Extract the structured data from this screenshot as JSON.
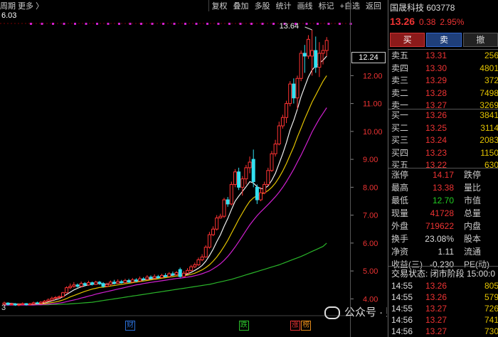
{
  "toolbar": {
    "crumb": "周期 更多 〉",
    "menu": [
      "复权",
      "叠加",
      "多股",
      "统计",
      "画线",
      "标记",
      "+自选",
      "返回"
    ]
  },
  "ma_label": "6.03",
  "chart_data": {
    "type": "candlestick",
    "y_ticks": [
      "12.00",
      "11.00",
      "10.00",
      "9.00",
      "8.00",
      "7.00",
      "6.00",
      "5.00",
      "4.00"
    ],
    "ylim": [
      3.5,
      14.2
    ],
    "current_price_tag": "12.24",
    "high_annotation": "13.64",
    "x_start_label": "3",
    "events": [
      {
        "label": "财",
        "color": "#2b6fd6"
      },
      {
        "label": "跌",
        "color": "#2bbf2b"
      },
      {
        "label": "涨",
        "color": "#e33333"
      },
      {
        "label": "榜",
        "color": "#e38a1a"
      }
    ],
    "candles": [
      {
        "o": 3.8,
        "c": 3.85,
        "h": 3.9,
        "l": 3.75
      },
      {
        "o": 3.85,
        "c": 3.8,
        "h": 3.88,
        "l": 3.76
      },
      {
        "o": 3.8,
        "c": 3.82,
        "h": 3.86,
        "l": 3.77
      },
      {
        "o": 3.82,
        "c": 3.78,
        "h": 3.85,
        "l": 3.75
      },
      {
        "o": 3.78,
        "c": 3.8,
        "h": 3.84,
        "l": 3.74
      },
      {
        "o": 3.8,
        "c": 3.83,
        "h": 3.87,
        "l": 3.78
      },
      {
        "o": 3.83,
        "c": 3.79,
        "h": 3.85,
        "l": 3.76
      },
      {
        "o": 3.79,
        "c": 3.82,
        "h": 3.86,
        "l": 3.77
      },
      {
        "o": 3.82,
        "c": 3.86,
        "h": 3.9,
        "l": 3.8
      },
      {
        "o": 3.86,
        "c": 3.84,
        "h": 3.9,
        "l": 3.8
      },
      {
        "o": 3.84,
        "c": 3.88,
        "h": 3.92,
        "l": 3.82
      },
      {
        "o": 3.88,
        "c": 3.92,
        "h": 3.96,
        "l": 3.85
      },
      {
        "o": 3.92,
        "c": 3.96,
        "h": 4.02,
        "l": 3.9
      },
      {
        "o": 3.96,
        "c": 4.02,
        "h": 4.08,
        "l": 3.92
      },
      {
        "o": 4.02,
        "c": 4.05,
        "h": 4.1,
        "l": 3.98
      },
      {
        "o": 4.05,
        "c": 4.08,
        "h": 4.12,
        "l": 4.0
      },
      {
        "o": 4.08,
        "c": 4.22,
        "h": 4.25,
        "l": 4.05
      },
      {
        "o": 4.22,
        "c": 4.4,
        "h": 4.45,
        "l": 4.2
      },
      {
        "o": 4.4,
        "c": 4.45,
        "h": 4.55,
        "l": 4.35
      },
      {
        "o": 4.45,
        "c": 4.5,
        "h": 4.6,
        "l": 4.4
      },
      {
        "o": 4.5,
        "c": 4.45,
        "h": 4.55,
        "l": 4.4
      },
      {
        "o": 4.45,
        "c": 4.55,
        "h": 4.62,
        "l": 4.42
      },
      {
        "o": 4.55,
        "c": 4.5,
        "h": 4.6,
        "l": 4.45
      },
      {
        "o": 4.5,
        "c": 4.58,
        "h": 4.65,
        "l": 4.47
      },
      {
        "o": 4.58,
        "c": 4.52,
        "h": 4.62,
        "l": 4.48
      },
      {
        "o": 4.52,
        "c": 4.6,
        "h": 4.65,
        "l": 4.5
      },
      {
        "o": 4.6,
        "c": 4.55,
        "h": 4.64,
        "l": 4.5
      },
      {
        "o": 4.55,
        "c": 4.45,
        "h": 4.6,
        "l": 4.4
      },
      {
        "o": 4.45,
        "c": 4.52,
        "h": 4.58,
        "l": 4.42
      },
      {
        "o": 4.52,
        "c": 4.6,
        "h": 4.66,
        "l": 4.48
      },
      {
        "o": 4.6,
        "c": 4.56,
        "h": 4.68,
        "l": 4.52
      },
      {
        "o": 4.56,
        "c": 4.62,
        "h": 4.7,
        "l": 4.54
      },
      {
        "o": 4.62,
        "c": 4.58,
        "h": 4.68,
        "l": 4.55
      },
      {
        "o": 4.58,
        "c": 4.66,
        "h": 4.72,
        "l": 4.55
      },
      {
        "o": 4.66,
        "c": 4.6,
        "h": 4.72,
        "l": 4.58
      },
      {
        "o": 4.6,
        "c": 4.68,
        "h": 4.75,
        "l": 4.58
      },
      {
        "o": 4.68,
        "c": 4.64,
        "h": 4.74,
        "l": 4.6
      },
      {
        "o": 4.64,
        "c": 4.72,
        "h": 4.8,
        "l": 4.62
      },
      {
        "o": 4.72,
        "c": 4.7,
        "h": 4.78,
        "l": 4.66
      },
      {
        "o": 4.7,
        "c": 4.78,
        "h": 4.85,
        "l": 4.68
      },
      {
        "o": 4.78,
        "c": 4.74,
        "h": 4.84,
        "l": 4.7
      },
      {
        "o": 4.74,
        "c": 4.8,
        "h": 4.88,
        "l": 4.7
      },
      {
        "o": 4.8,
        "c": 4.76,
        "h": 4.86,
        "l": 4.72
      },
      {
        "o": 4.76,
        "c": 4.84,
        "h": 4.9,
        "l": 4.74
      },
      {
        "o": 4.84,
        "c": 4.8,
        "h": 4.92,
        "l": 4.78
      },
      {
        "o": 4.8,
        "c": 4.9,
        "h": 4.96,
        "l": 4.78
      },
      {
        "o": 4.9,
        "c": 4.86,
        "h": 4.98,
        "l": 4.82
      },
      {
        "o": 4.86,
        "c": 4.94,
        "h": 5.0,
        "l": 4.84
      },
      {
        "o": 5.05,
        "c": 4.8,
        "h": 5.12,
        "l": 4.76
      },
      {
        "o": 4.8,
        "c": 4.92,
        "h": 5.0,
        "l": 4.78
      },
      {
        "o": 4.92,
        "c": 5.02,
        "h": 5.1,
        "l": 4.9
      },
      {
        "o": 5.02,
        "c": 5.15,
        "h": 5.22,
        "l": 4.98
      },
      {
        "o": 5.15,
        "c": 5.22,
        "h": 5.3,
        "l": 5.1
      },
      {
        "o": 5.22,
        "c": 5.4,
        "h": 5.48,
        "l": 5.18
      },
      {
        "o": 5.4,
        "c": 5.5,
        "h": 5.6,
        "l": 5.35
      },
      {
        "o": 5.5,
        "c": 5.85,
        "h": 5.92,
        "l": 5.48
      },
      {
        "o": 5.85,
        "c": 6.3,
        "h": 6.4,
        "l": 5.8
      },
      {
        "o": 6.3,
        "c": 6.5,
        "h": 6.6,
        "l": 6.25
      },
      {
        "o": 6.5,
        "c": 6.9,
        "h": 7.0,
        "l": 6.45
      },
      {
        "o": 6.9,
        "c": 6.96,
        "h": 7.05,
        "l": 6.88
      },
      {
        "o": 6.96,
        "c": 7.55,
        "h": 7.62,
        "l": 6.9
      },
      {
        "o": 7.55,
        "c": 7.4,
        "h": 7.65,
        "l": 7.3
      },
      {
        "o": 7.4,
        "c": 8.1,
        "h": 8.2,
        "l": 7.35
      },
      {
        "o": 8.1,
        "c": 8.55,
        "h": 8.65,
        "l": 8.0
      },
      {
        "o": 8.55,
        "c": 8.0,
        "h": 8.7,
        "l": 7.9
      },
      {
        "o": 8.0,
        "c": 8.3,
        "h": 8.4,
        "l": 7.7
      },
      {
        "o": 8.3,
        "c": 8.7,
        "h": 8.8,
        "l": 8.1
      },
      {
        "o": 8.7,
        "c": 8.9,
        "h": 9.1,
        "l": 8.5
      },
      {
        "o": 9.0,
        "c": 8.2,
        "h": 9.35,
        "l": 8.0
      },
      {
        "o": 8.0,
        "c": 7.55,
        "h": 8.1,
        "l": 7.4
      },
      {
        "o": 7.55,
        "c": 7.8,
        "h": 8.0,
        "l": 7.5
      },
      {
        "o": 7.8,
        "c": 8.1,
        "h": 8.2,
        "l": 7.75
      },
      {
        "o": 8.1,
        "c": 8.6,
        "h": 8.7,
        "l": 8.05
      },
      {
        "o": 8.6,
        "c": 9.2,
        "h": 9.3,
        "l": 8.55
      },
      {
        "o": 9.2,
        "c": 9.55,
        "h": 9.7,
        "l": 9.1
      },
      {
        "o": 9.55,
        "c": 10.2,
        "h": 10.35,
        "l": 9.5
      },
      {
        "o": 10.2,
        "c": 10.5,
        "h": 10.6,
        "l": 10.1
      },
      {
        "o": 10.5,
        "c": 11.0,
        "h": 11.1,
        "l": 10.3
      },
      {
        "o": 11.0,
        "c": 11.7,
        "h": 11.8,
        "l": 10.9
      },
      {
        "o": 11.7,
        "c": 11.2,
        "h": 11.9,
        "l": 11.0
      },
      {
        "o": 11.2,
        "c": 11.9,
        "h": 12.0,
        "l": 10.8
      },
      {
        "o": 11.9,
        "c": 12.8,
        "h": 12.9,
        "l": 11.8
      },
      {
        "o": 12.8,
        "c": 12.7,
        "h": 13.1,
        "l": 12.1
      },
      {
        "o": 12.7,
        "c": 13.3,
        "h": 13.45,
        "l": 12.6
      },
      {
        "o": 12.7,
        "c": 12.9,
        "h": 13.64,
        "l": 12.0
      },
      {
        "o": 12.9,
        "c": 12.3,
        "h": 13.4,
        "l": 12.1
      },
      {
        "o": 12.3,
        "c": 12.8,
        "h": 13.2,
        "l": 11.95
      },
      {
        "o": 12.8,
        "c": 12.9,
        "h": 13.1,
        "l": 12.4
      },
      {
        "o": 12.9,
        "c": 13.26,
        "h": 13.38,
        "l": 12.7
      }
    ],
    "ma_white": [
      3.85,
      3.84,
      3.83,
      3.82,
      3.81,
      3.81,
      3.81,
      3.81,
      3.82,
      3.83,
      3.84,
      3.86,
      3.89,
      3.93,
      3.97,
      4.01,
      4.08,
      4.16,
      4.24,
      4.32,
      4.38,
      4.43,
      4.47,
      4.5,
      4.52,
      4.54,
      4.55,
      4.53,
      4.53,
      4.54,
      4.55,
      4.57,
      4.58,
      4.6,
      4.61,
      4.63,
      4.64,
      4.66,
      4.68,
      4.7,
      4.72,
      4.74,
      4.76,
      4.78,
      4.8,
      4.83,
      4.85,
      4.87,
      4.85,
      4.86,
      4.89,
      4.95,
      5.02,
      5.1,
      5.2,
      5.35,
      5.55,
      5.78,
      6.05,
      6.3,
      6.6,
      6.88,
      7.2,
      7.5,
      7.68,
      7.85,
      8.02,
      8.2,
      8.15,
      8.02,
      7.95,
      7.95,
      8.05,
      8.25,
      8.5,
      8.85,
      9.2,
      9.6,
      10.05,
      10.4,
      10.8,
      11.25,
      11.6,
      11.95,
      12.2,
      12.35,
      12.45,
      12.55,
      12.7
    ],
    "ma_yellow": [
      3.82,
      3.82,
      3.82,
      3.81,
      3.81,
      3.81,
      3.81,
      3.81,
      3.81,
      3.82,
      3.82,
      3.83,
      3.85,
      3.87,
      3.89,
      3.92,
      3.96,
      4.01,
      4.07,
      4.12,
      4.17,
      4.22,
      4.27,
      4.31,
      4.35,
      4.38,
      4.41,
      4.42,
      4.44,
      4.46,
      4.48,
      4.5,
      4.52,
      4.54,
      4.56,
      4.58,
      4.6,
      4.62,
      4.64,
      4.66,
      4.68,
      4.7,
      4.72,
      4.74,
      4.76,
      4.78,
      4.8,
      4.82,
      4.82,
      4.83,
      4.85,
      4.88,
      4.92,
      4.98,
      5.04,
      5.12,
      5.22,
      5.35,
      5.5,
      5.68,
      5.88,
      6.1,
      6.35,
      6.6,
      6.85,
      7.08,
      7.3,
      7.5,
      7.62,
      7.7,
      7.75,
      7.8,
      7.88,
      8.0,
      8.15,
      8.35,
      8.58,
      8.85,
      9.15,
      9.45,
      9.8,
      10.12,
      10.45,
      10.75,
      11.05,
      11.3,
      11.55,
      11.8,
      12.0
    ],
    "ma_magenta": [
      3.78,
      3.78,
      3.78,
      3.78,
      3.78,
      3.78,
      3.78,
      3.78,
      3.78,
      3.79,
      3.79,
      3.8,
      3.81,
      3.82,
      3.83,
      3.85,
      3.87,
      3.9,
      3.93,
      3.96,
      3.99,
      4.03,
      4.06,
      4.1,
      4.13,
      4.17,
      4.2,
      4.23,
      4.26,
      4.29,
      4.32,
      4.35,
      4.38,
      4.41,
      4.44,
      4.47,
      4.5,
      4.52,
      4.55,
      4.57,
      4.59,
      4.61,
      4.63,
      4.65,
      4.67,
      4.69,
      4.71,
      4.73,
      4.74,
      4.76,
      4.78,
      4.8,
      4.83,
      4.86,
      4.9,
      4.95,
      5.0,
      5.08,
      5.16,
      5.26,
      5.38,
      5.52,
      5.68,
      5.86,
      6.05,
      6.25,
      6.45,
      6.65,
      6.82,
      6.98,
      7.12,
      7.25,
      7.38,
      7.52,
      7.66,
      7.82,
      8.0,
      8.2,
      8.42,
      8.65,
      8.9,
      9.15,
      9.42,
      9.7,
      9.98,
      10.22,
      10.45,
      10.65,
      10.85
    ],
    "ma_green": [
      3.8,
      3.8,
      3.8,
      3.8,
      3.8,
      3.8,
      3.79,
      3.79,
      3.79,
      3.79,
      3.79,
      3.79,
      3.79,
      3.8,
      3.8,
      3.8,
      3.81,
      3.81,
      3.82,
      3.83,
      3.84,
      3.85,
      3.86,
      3.87,
      3.88,
      3.9,
      3.92,
      3.94,
      3.96,
      3.98,
      4.0,
      4.02,
      4.04,
      4.06,
      4.08,
      4.1,
      4.12,
      4.14,
      4.16,
      4.18,
      4.2,
      4.22,
      4.24,
      4.26,
      4.28,
      4.3,
      4.32,
      4.34,
      4.36,
      4.38,
      4.4,
      4.42,
      4.44,
      4.46,
      4.48,
      4.5,
      4.52,
      4.55,
      4.58,
      4.61,
      4.64,
      4.67,
      4.7,
      4.74,
      4.78,
      4.82,
      4.86,
      4.9,
      4.94,
      4.98,
      5.02,
      5.06,
      5.1,
      5.14,
      5.18,
      5.22,
      5.27,
      5.32,
      5.37,
      5.42,
      5.47,
      5.52,
      5.58,
      5.64,
      5.7,
      5.76,
      5.82,
      5.88,
      6.0
    ]
  },
  "stock": {
    "title": "国晟科技 603778",
    "price": "13.26",
    "change": "0.38",
    "pct": "2.95%"
  },
  "trade_buttons": {
    "buy": "买",
    "sell": "卖",
    "cancel": "撤"
  },
  "asks": [
    {
      "label": "卖五",
      "price": "13.31",
      "vol": "256"
    },
    {
      "label": "卖四",
      "price": "13.30",
      "vol": "4801"
    },
    {
      "label": "卖三",
      "price": "13.29",
      "vol": "372"
    },
    {
      "label": "卖二",
      "price": "13.28",
      "vol": "7498"
    },
    {
      "label": "卖一",
      "price": "13.27",
      "vol": "3269"
    }
  ],
  "bids": [
    {
      "label": "买一",
      "price": "13.26",
      "vol": "3841"
    },
    {
      "label": "买二",
      "price": "13.25",
      "vol": "3114"
    },
    {
      "label": "买三",
      "price": "13.24",
      "vol": "2083"
    },
    {
      "label": "买四",
      "price": "13.23",
      "vol": "1150"
    },
    {
      "label": "买五",
      "price": "13.22",
      "vol": "630"
    }
  ],
  "stats": [
    {
      "k1": "涨停",
      "v1": "14.17",
      "c1": "red",
      "k2": "跌停"
    },
    {
      "k1": "最高",
      "v1": "13.38",
      "c1": "red",
      "k2": "量比"
    },
    {
      "k1": "最低",
      "v1": "12.70",
      "c1": "green",
      "k2": "市值"
    },
    {
      "k1": "现量",
      "v1": "41728",
      "c1": "red",
      "k2": "总量"
    },
    {
      "k1": "外盘",
      "v1": "719622",
      "c1": "red",
      "k2": "内盘"
    },
    {
      "k1": "换手",
      "v1": "23.08%",
      "c1": "white",
      "k2": "股本"
    },
    {
      "k1": "净资",
      "v1": "1.11",
      "c1": "white",
      "k2": "流通"
    },
    {
      "k1": "收益(三)",
      "v1": "-0.230",
      "c1": "white",
      "k2": "PE(动)"
    }
  ],
  "status_text": "交易状态: 闭市阶段 15:00:0",
  "ticks": [
    {
      "time": "14:55",
      "price": "13.26",
      "vol": "805"
    },
    {
      "time": "14:55",
      "price": "13.26",
      "vol": "579"
    },
    {
      "time": "14:55",
      "price": "13.27",
      "vol": "726"
    },
    {
      "time": "14:56",
      "price": "13.27",
      "vol": "741"
    },
    {
      "time": "14:56",
      "price": "13.27",
      "vol": "730"
    }
  ],
  "watermark": "公众号 · 财可直司机"
}
